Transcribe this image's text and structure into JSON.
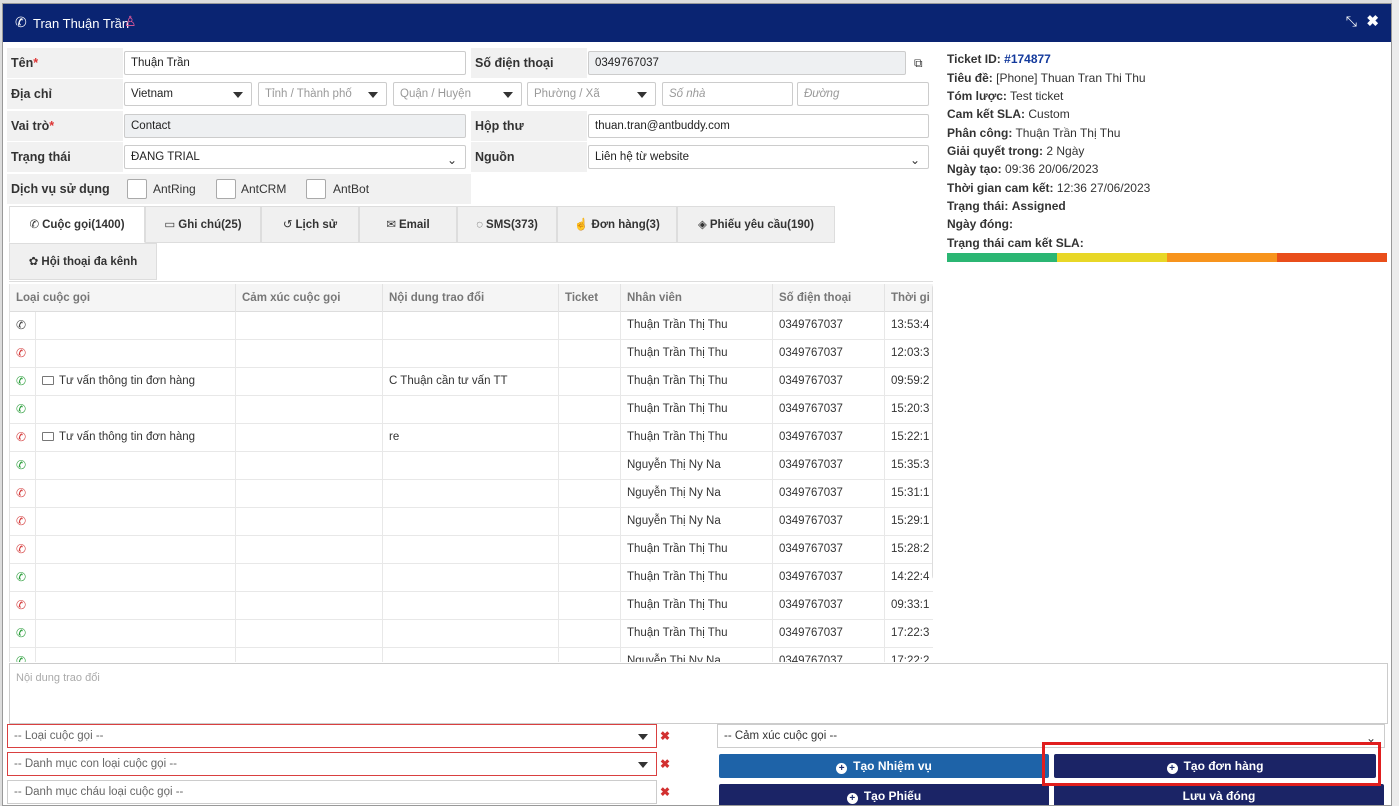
{
  "titlebar": {
    "name": "Tran Thuận Trần"
  },
  "form": {
    "ten_label": "Tên",
    "ten_value": "Thuận Trần",
    "sdt_label": "Số điện thoại",
    "sdt_value": "0349767037",
    "diachi_label": "Địa chỉ",
    "country": "Vietnam",
    "province_ph": "Tỉnh / Thành phố",
    "district_ph": "Quận / Huyện",
    "ward_ph": "Phường / Xã",
    "house_ph": "Số nhà",
    "street_ph": "Đường",
    "vaitro_label": "Vai trò",
    "vaitro_value": "Contact",
    "hopthu_label": "Hộp thư",
    "hopthu_value": "thuan.tran@antbuddy.com",
    "trangthai_label": "Trạng thái",
    "trangthai_value": "ĐANG TRIAL",
    "nguon_label": "Nguồn",
    "nguon_value": "Liên hệ từ website",
    "dichvu_label": "Dịch vụ sử dụng",
    "services": [
      "AntRing",
      "AntCRM",
      "AntBot"
    ]
  },
  "tabs": [
    {
      "label": "Cuộc gọi(1400)",
      "icon": "phone-icon",
      "glyph": "✆"
    },
    {
      "label": "Ghi chú(25)",
      "icon": "note-icon",
      "glyph": "▭"
    },
    {
      "label": "Lịch sử",
      "icon": "history-icon",
      "glyph": "↺"
    },
    {
      "label": "Email",
      "icon": "email-icon",
      "glyph": "✉"
    },
    {
      "label": "SMS(373)",
      "icon": "sms-icon",
      "glyph": "◌"
    },
    {
      "label": "Đơn hàng(3)",
      "icon": "order-icon",
      "glyph": "☝"
    },
    {
      "label": "Phiếu yêu cầu(190)",
      "icon": "ticket-icon",
      "glyph": "◈"
    },
    {
      "label": "Hội thoại đa kênh",
      "icon": "multichannel-icon",
      "glyph": "✿"
    }
  ],
  "table": {
    "columns": [
      "Loại cuộc gọi",
      "Cảm xúc cuộc gọi",
      "Nội dung trao đổi",
      "Ticket",
      "Nhân viên",
      "Số điện thoại",
      "Thời gi"
    ],
    "rows": [
      {
        "dir": "neutral",
        "type": "",
        "content": "",
        "staff": "Thuận Trần Thị Thu",
        "phone": "0349767037",
        "time": "13:53:4"
      },
      {
        "dir": "out",
        "type": "",
        "content": "",
        "staff": "Thuận Trần Thị Thu",
        "phone": "0349767037",
        "time": "12:03:3"
      },
      {
        "dir": "in",
        "type": "Tư vấn thông tin đơn hàng",
        "content": "C Thuận cần tư vấn TT",
        "staff": "Thuận Trần Thị Thu",
        "phone": "0349767037",
        "time": "09:59:2"
      },
      {
        "dir": "in",
        "type": "",
        "content": "",
        "staff": "Thuận Trần Thị Thu",
        "phone": "0349767037",
        "time": "15:20:3"
      },
      {
        "dir": "out",
        "type": "Tư vấn thông tin đơn hàng",
        "content": "re",
        "staff": "Thuận Trần Thị Thu",
        "phone": "0349767037",
        "time": "15:22:1"
      },
      {
        "dir": "in",
        "type": "",
        "content": "",
        "staff": "Nguyễn Thị Ny Na",
        "phone": "0349767037",
        "time": "15:35:3"
      },
      {
        "dir": "out",
        "type": "",
        "content": "",
        "staff": "Nguyễn Thị Ny Na",
        "phone": "0349767037",
        "time": "15:31:1"
      },
      {
        "dir": "out",
        "type": "",
        "content": "",
        "staff": "Nguyễn Thị Ny Na",
        "phone": "0349767037",
        "time": "15:29:1"
      },
      {
        "dir": "out",
        "type": "",
        "content": "",
        "staff": "Thuận Trần Thị Thu",
        "phone": "0349767037",
        "time": "15:28:2"
      },
      {
        "dir": "in",
        "type": "",
        "content": "",
        "staff": "Thuận Trần Thị Thu",
        "phone": "0349767037",
        "time": "14:22:4"
      },
      {
        "dir": "out",
        "type": "",
        "content": "",
        "staff": "Thuận Trần Thị Thu",
        "phone": "0349767037",
        "time": "09:33:1"
      },
      {
        "dir": "in",
        "type": "",
        "content": "",
        "staff": "Thuận Trần Thị Thu",
        "phone": "0349767037",
        "time": "17:22:3"
      },
      {
        "dir": "in",
        "type": "",
        "content": "",
        "staff": "Nguyễn Thị Ny Na",
        "phone": "0349767037",
        "time": "17:22:2"
      }
    ]
  },
  "note": {
    "placeholder": "Nội dung trao đổi"
  },
  "bottom": {
    "loai_ph": "-- Loại cuộc gọi --",
    "danhmuc_con_ph": "-- Danh mục con loại cuộc gọi --",
    "danhmuc_chau_ph": "-- Danh mục cháu loại cuộc gọi --",
    "camxuc_ph": "-- Cảm xúc cuộc gọi --",
    "tao_nhiemvu": "Tạo Nhiệm vụ",
    "tao_donhang": "Tạo đơn hàng",
    "tao_phieu": "Tạo Phiếu",
    "luu_dong": "Lưu và đóng"
  },
  "ticket": {
    "id_label": "Ticket ID:",
    "id_value": "#174877",
    "tieude_label": "Tiêu đề:",
    "tieude_value": "[Phone] Thuan Tran Thi Thu",
    "tomluoc_label": "Tóm lược:",
    "tomluoc_value": "Test ticket",
    "sla_label": "Cam kết SLA:",
    "sla_value": "Custom",
    "phancong_label": "Phân công:",
    "phancong_value": "Thuận Trần Thị Thu",
    "giaiquyet_label": "Giải quyết trong:",
    "giaiquyet_value": "2 Ngày",
    "ngaytao_label": "Ngày tạo:",
    "ngaytao_value": "09:36 20/06/2023",
    "tgcamket_label": "Thời gian cam kết:",
    "tgcamket_value": "12:36 27/06/2023",
    "trangthai_label": "Trạng thái:",
    "trangthai_value": "Assigned",
    "ngaydong_label": "Ngày đóng:",
    "slastatus_label": "Trạng thái cam kết SLA:",
    "sla_colors": [
      "#2bb673",
      "#e8d727",
      "#f7941d",
      "#e94e1b"
    ]
  }
}
